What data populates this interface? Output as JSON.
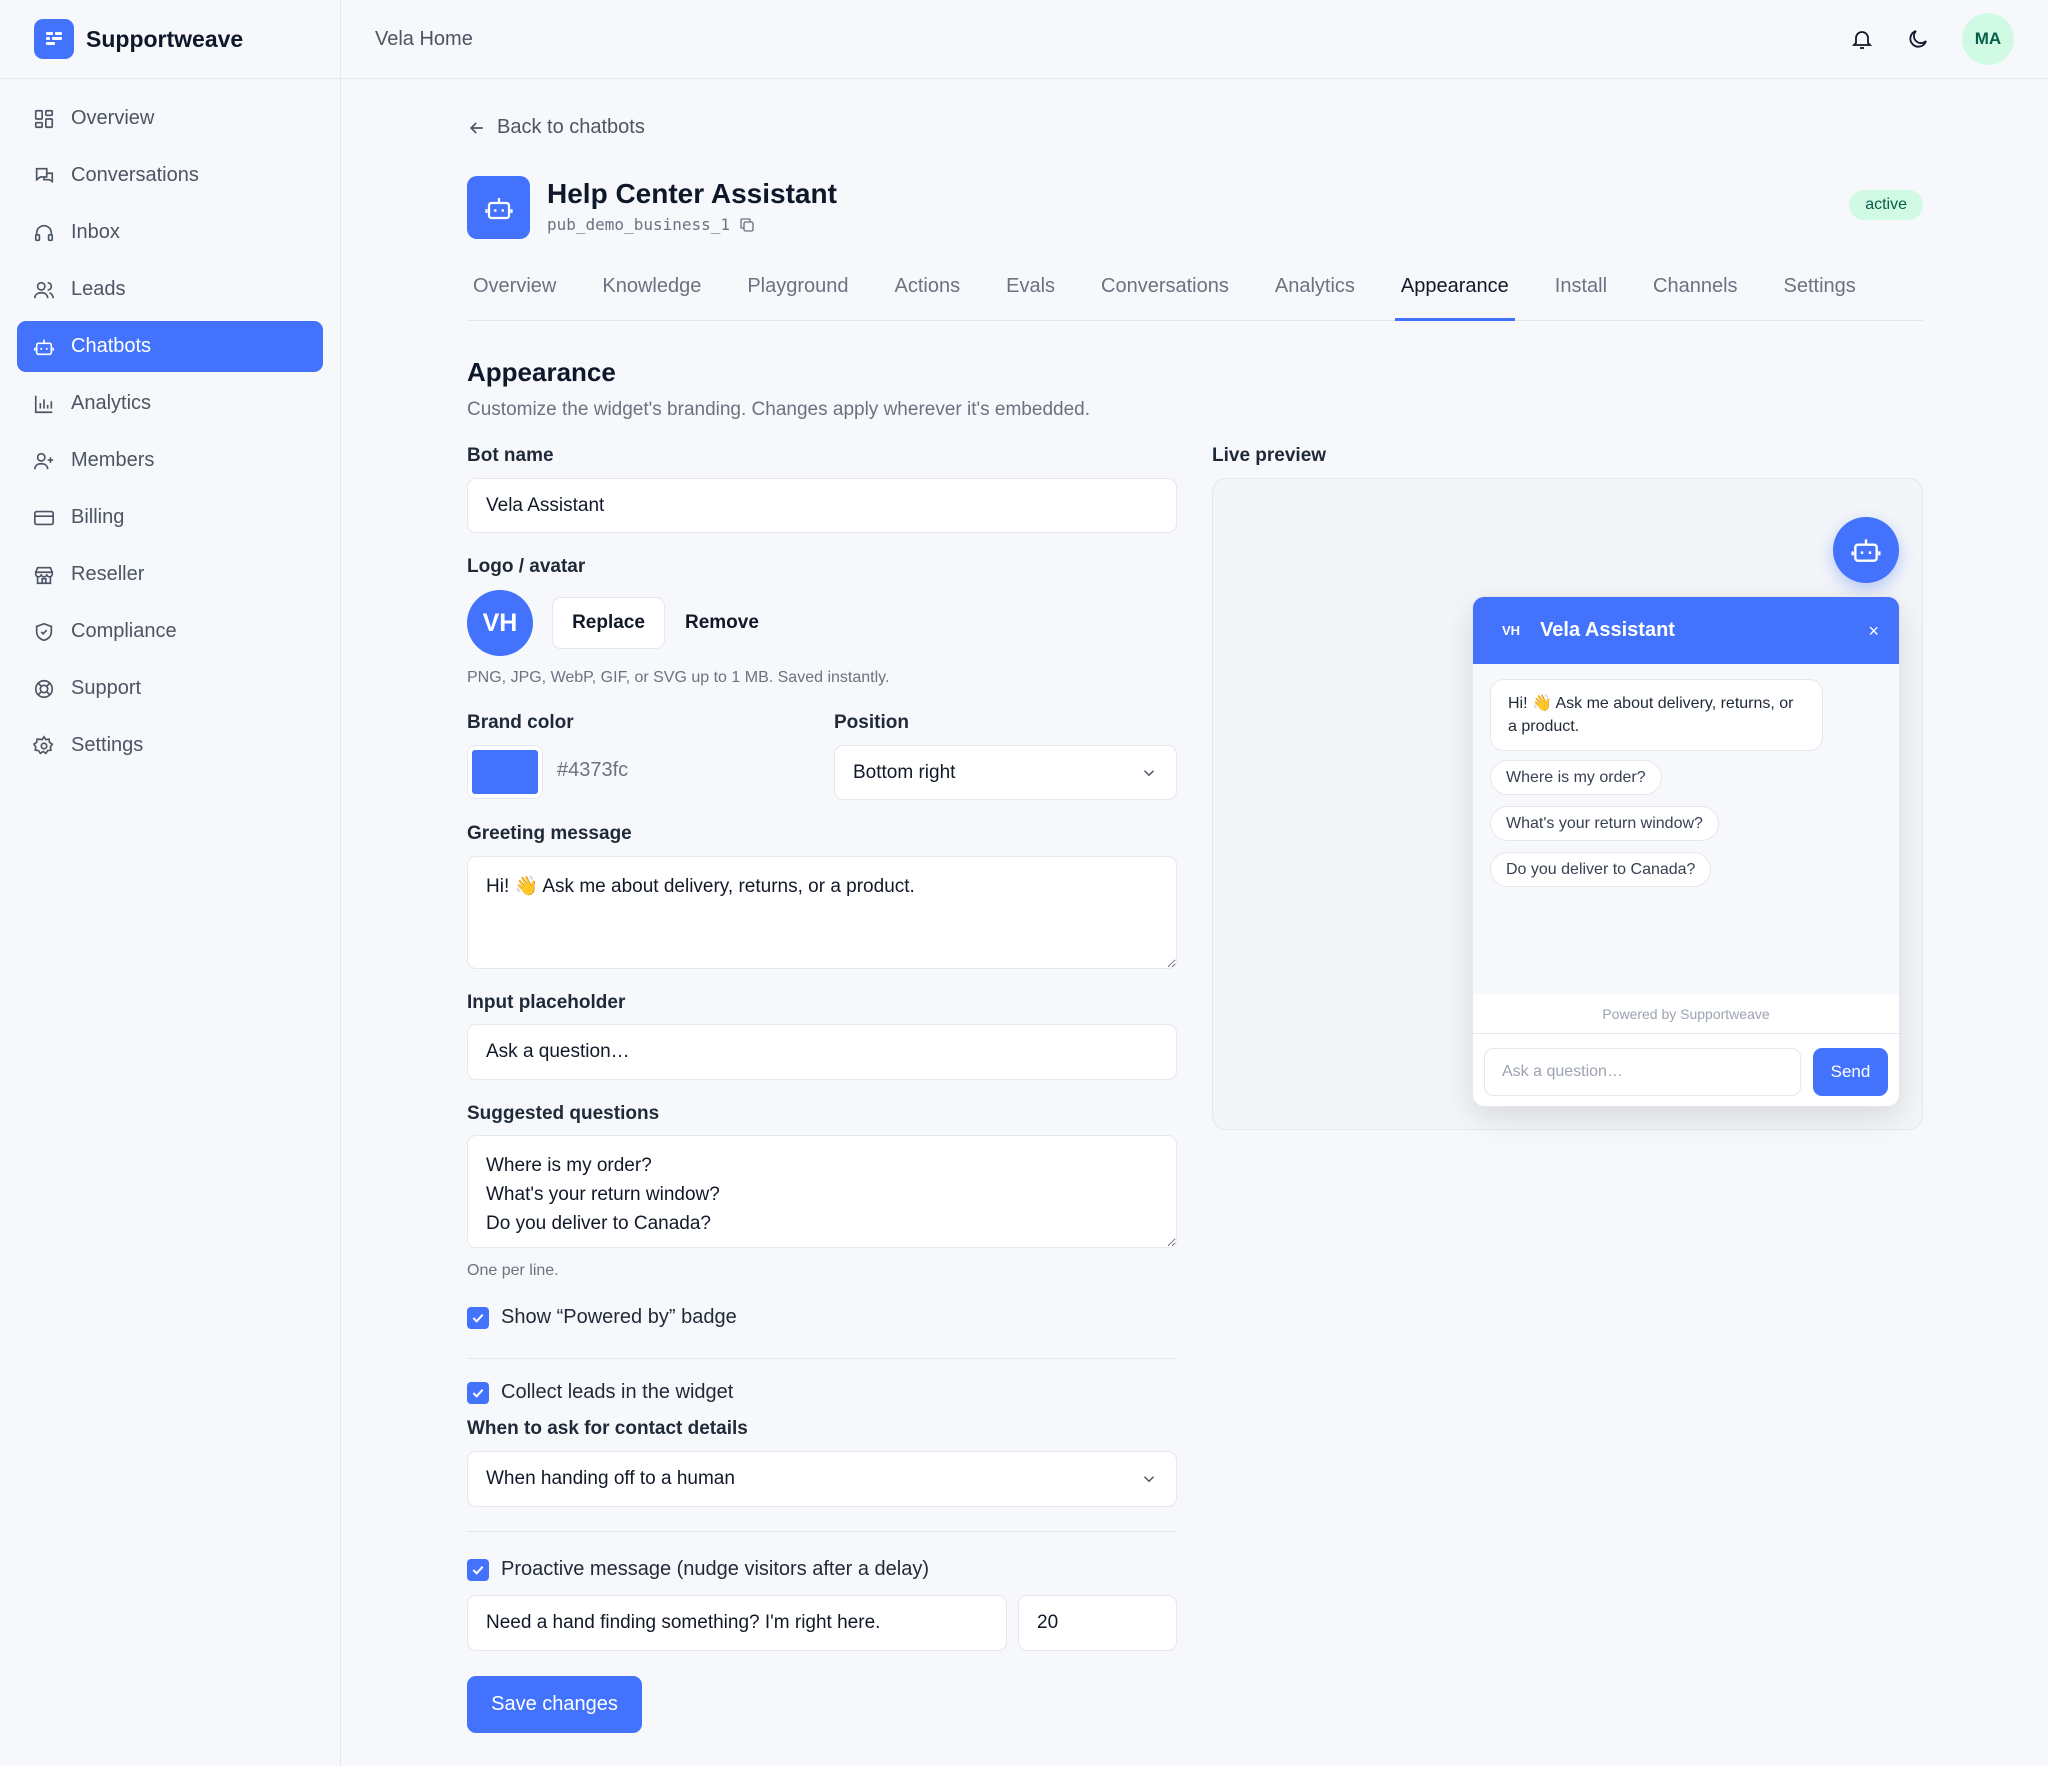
{
  "brand": {
    "name": "Supportweave"
  },
  "sidebar": {
    "items": [
      {
        "label": "Overview",
        "icon": "grid-icon"
      },
      {
        "label": "Conversations",
        "icon": "chat-icon"
      },
      {
        "label": "Inbox",
        "icon": "headset-icon"
      },
      {
        "label": "Leads",
        "icon": "users-icon"
      },
      {
        "label": "Chatbots",
        "icon": "bot-icon",
        "active": true
      },
      {
        "label": "Analytics",
        "icon": "bar-chart-icon"
      },
      {
        "label": "Members",
        "icon": "user-plus-icon"
      },
      {
        "label": "Billing",
        "icon": "card-icon"
      },
      {
        "label": "Reseller",
        "icon": "store-icon"
      },
      {
        "label": "Compliance",
        "icon": "shield-icon"
      },
      {
        "label": "Support",
        "icon": "lifebuoy-icon"
      },
      {
        "label": "Settings",
        "icon": "gear-icon"
      }
    ]
  },
  "header": {
    "workspace": "Vela Home",
    "user_initials": "MA"
  },
  "page": {
    "back_label": "Back to chatbots",
    "bot_title": "Help Center Assistant",
    "bot_id": "pub_demo_business_1",
    "status": "active",
    "tabs": [
      "Overview",
      "Knowledge",
      "Playground",
      "Actions",
      "Evals",
      "Conversations",
      "Analytics",
      "Appearance",
      "Install",
      "Channels",
      "Settings"
    ],
    "active_tab": "Appearance"
  },
  "appearance": {
    "title": "Appearance",
    "subtitle": "Customize the widget's branding. Changes apply wherever it's embedded.",
    "bot_name_label": "Bot name",
    "bot_name_value": "Vela Assistant",
    "logo_label": "Logo / avatar",
    "logo_initials": "VH",
    "replace_label": "Replace",
    "remove_label": "Remove",
    "logo_hint": "PNG, JPG, WebP, GIF, or SVG up to 1 MB. Saved instantly.",
    "brand_color_label": "Brand color",
    "brand_color_value": "#4373fc",
    "position_label": "Position",
    "position_value": "Bottom right",
    "greeting_label": "Greeting message",
    "greeting_value": "Hi! 👋 Ask me about delivery, returns, or a product.",
    "placeholder_label": "Input placeholder",
    "placeholder_value": "Ask a question…",
    "suggested_label": "Suggested questions",
    "suggested_value": "Where is my order?\nWhat's your return window?\nDo you deliver to Canada?",
    "suggested_hint": "One per line.",
    "powered_by_label": "Show “Powered by” badge",
    "collect_leads_label": "Collect leads in the widget",
    "contact_when_label": "When to ask for contact details",
    "contact_when_value": "When handing off to a human",
    "proactive_label": "Proactive message (nudge visitors after a delay)",
    "proactive_message": "Need a hand finding something? I'm right here.",
    "proactive_delay": "20",
    "save_label": "Save changes"
  },
  "preview": {
    "label": "Live preview",
    "widget_initials": "VH",
    "widget_title": "Vela Assistant",
    "close_glyph": "×",
    "greeting": "Hi! 👋 Ask me about delivery, returns, or a product.",
    "chips": [
      "Where is my order?",
      "What's your return window?",
      "Do you deliver to Canada?"
    ],
    "powered": "Powered by Supportweave",
    "input_placeholder": "Ask a question…",
    "send_label": "Send"
  },
  "colors": {
    "accent": "#4373fc",
    "status_bg": "#d1fae5",
    "status_text": "#065f46"
  }
}
